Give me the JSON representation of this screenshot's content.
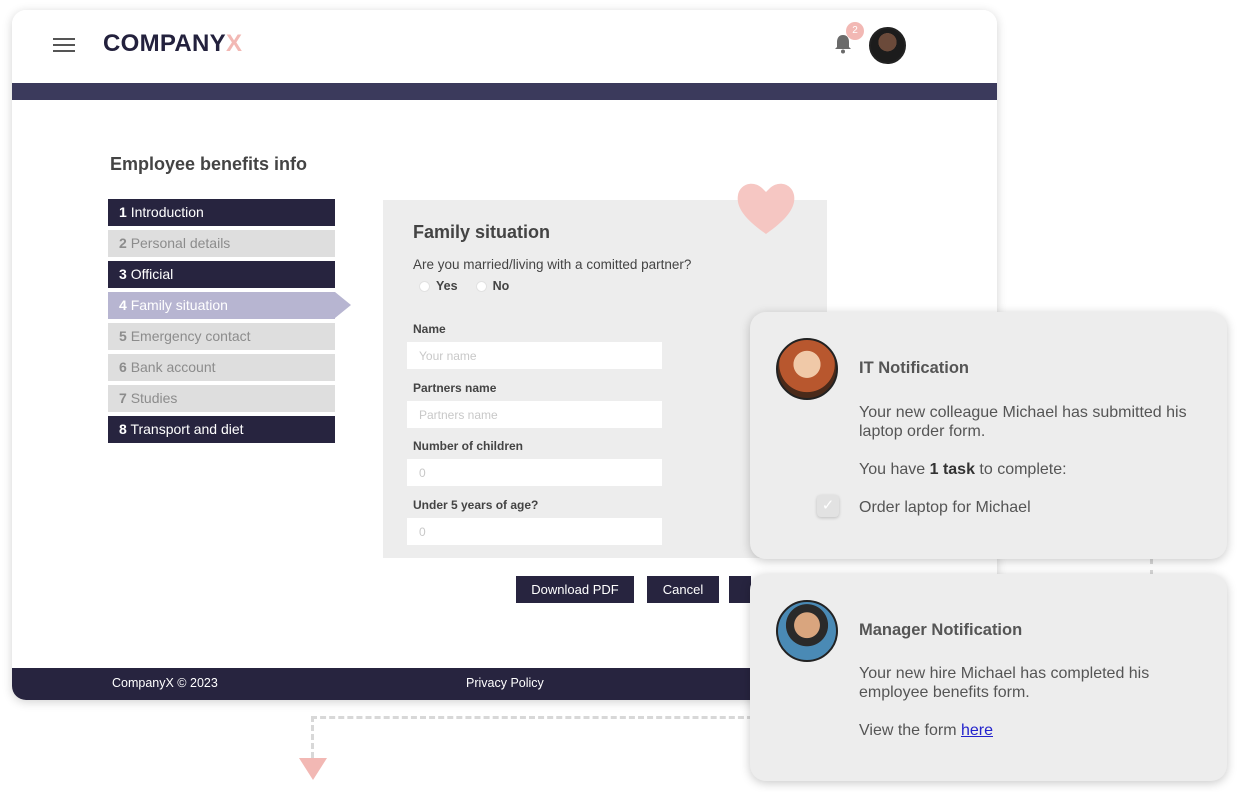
{
  "header": {
    "logo_main": "COMPANY",
    "logo_accent": "X",
    "notification_count": "2"
  },
  "page": {
    "title": "Employee benefits info"
  },
  "steps": [
    {
      "num": "1",
      "label": "Introduction",
      "state": "dark"
    },
    {
      "num": "2",
      "label": "Personal details",
      "state": "light"
    },
    {
      "num": "3",
      "label": "Official",
      "state": "dark"
    },
    {
      "num": "4",
      "label": "Family situation",
      "state": "active"
    },
    {
      "num": "5",
      "label": "Emergency contact",
      "state": "light"
    },
    {
      "num": "6",
      "label": "Bank account",
      "state": "light"
    },
    {
      "num": "7",
      "label": "Studies",
      "state": "light"
    },
    {
      "num": "8",
      "label": "Transport and diet",
      "state": "dark"
    }
  ],
  "form": {
    "title": "Family situation",
    "question": "Are you married/living with a comitted partner?",
    "yes_label": "Yes",
    "no_label": "No",
    "name_label": "Name",
    "name_placeholder": "Your name",
    "partner_label": "Partners name",
    "partner_placeholder": "Partners name",
    "children_label": "Number of children",
    "children_placeholder": "0",
    "under5_label": "Under 5 years of age?",
    "under5_placeholder": "0"
  },
  "actions": {
    "download_label": "Download PDF",
    "cancel_label": "Cancel"
  },
  "footer": {
    "copyright": "CompanyX © 2023",
    "privacy": "Privacy Policy"
  },
  "it_notification": {
    "title": "IT Notification",
    "message": "Your new colleague Michael has submitted his laptop order form.",
    "task_prefix": "You have ",
    "task_count": "1 task",
    "task_suffix": " to complete:",
    "task_item": "Order laptop for Michael"
  },
  "manager_notification": {
    "title": "Manager Notification",
    "message": "Your new hire Michael has completed his employee benefits form.",
    "view_prefix": "View the form ",
    "view_link": "here"
  },
  "colors": {
    "navy": "#27243f",
    "accent_pink": "#f2b8b4",
    "active_step": "#b7b5d1"
  }
}
